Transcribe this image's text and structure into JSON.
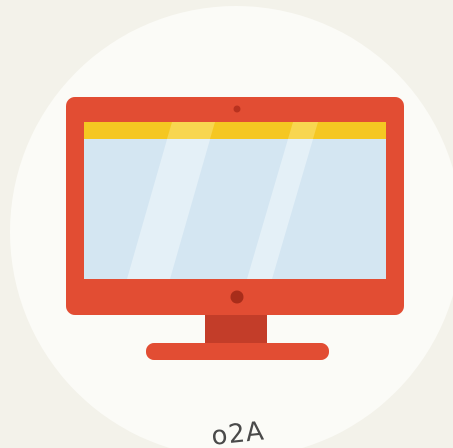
{
  "illustration": {
    "icon": "desktop-monitor-icon",
    "caption_fragment": "o2A"
  },
  "colors": {
    "page_background": "#f3f2ea",
    "circle": "#fbfbf7",
    "monitor_frame": "#e24d33",
    "monitor_frame_dark": "#c33d29",
    "screen": "#d4e6f2",
    "screen_highlight": "#e4f0f7",
    "top_bar": "#f5c722",
    "top_bar_highlight": "#f8d650",
    "camera_dot": "#b8321f",
    "power_button": "#a82d1a"
  }
}
